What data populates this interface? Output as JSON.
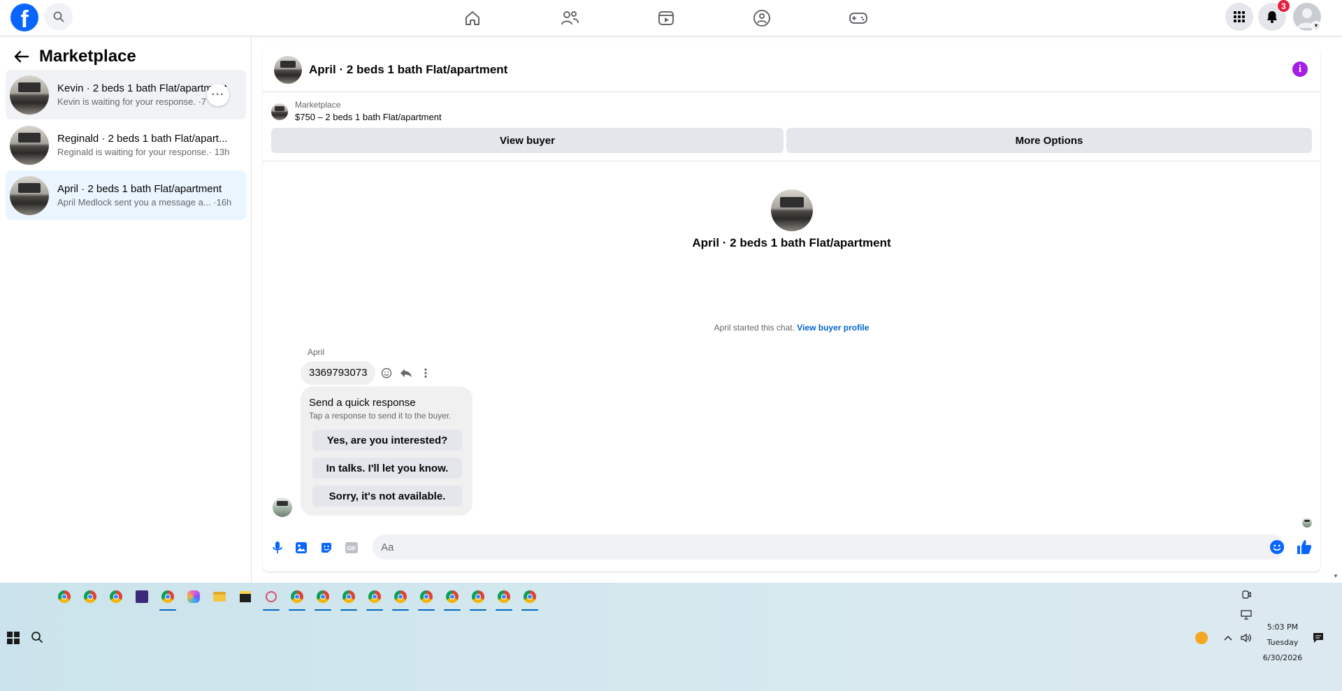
{
  "topnav": {
    "logo_letter": "f",
    "notifications_count": "3"
  },
  "sidebar": {
    "title": "Marketplace",
    "conversations": [
      {
        "title": "Kevin · 2 beds 1 bath Flat/apartment",
        "subtitle": "Kevin is waiting for your response. ·7"
      },
      {
        "title": "Reginald · 2 beds 1 bath Flat/apart...",
        "subtitle": "Reginald is waiting for your response.· 13h"
      },
      {
        "title": "April · 2 beds 1 bath Flat/apartment",
        "subtitle": "April Medlock sent you a message a...  ·16h"
      }
    ]
  },
  "chat": {
    "header_title": "April · 2 beds 1 bath Flat/apartment",
    "listing_label": "Marketplace",
    "listing_price": "$750 – 2 beds 1 bath Flat/apartment",
    "view_buyer": "View buyer",
    "more_options": "More Options",
    "center_title": "April · 2 beds 1 bath Flat/apartment",
    "started_text": "April started this chat.",
    "view_buyer_profile": "View buyer profile",
    "sender_name": "April",
    "message": "3369793073",
    "quick_title": "Send a quick response",
    "quick_subtitle": "Tap a response to send it to the buyer.",
    "quick_responses": [
      "Yes, are you interested?",
      "In talks. I'll let you know.",
      "Sorry, it's not available."
    ],
    "composer_placeholder": "Aa"
  },
  "taskbar": {
    "time": "5:03 PM",
    "day": "Tuesday",
    "date": "6/30/2026"
  },
  "colors": {
    "brand": "#0866ff",
    "link": "#0064d1",
    "badge": "#e41e3f",
    "info": "#a31ee6"
  }
}
